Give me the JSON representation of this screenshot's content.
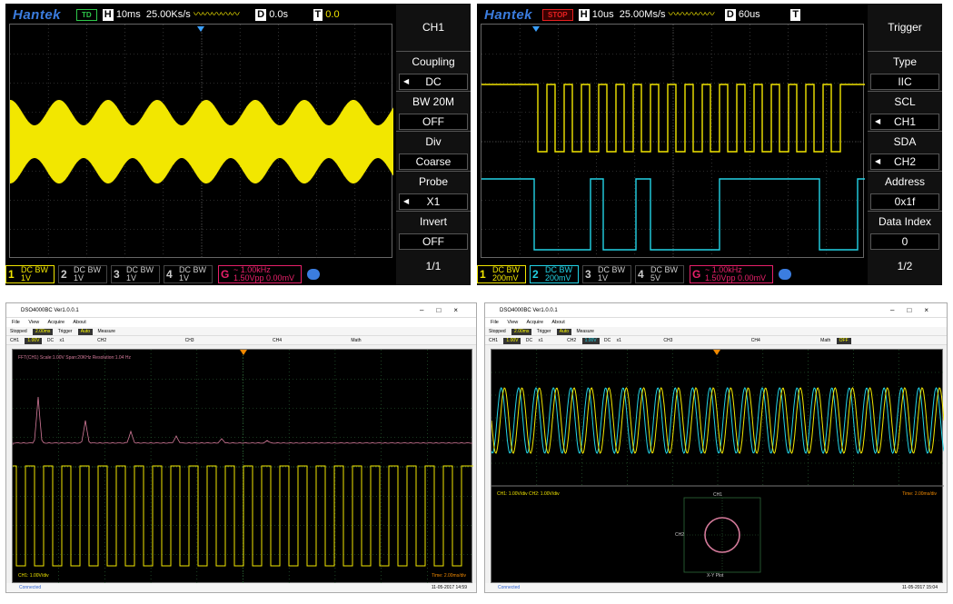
{
  "panels": {
    "tl": {
      "brand": "Hantek",
      "state": "TD",
      "time_base_label": "H",
      "time_base": "10ms",
      "sample_rate": "25.00Ks/s",
      "delay_label": "D",
      "delay": "0.0s",
      "trig_label": "T",
      "trig_level": "0.0",
      "menu_title": "CH1",
      "menu_items": [
        {
          "label": "Coupling",
          "value": "DC",
          "arrow": true
        },
        {
          "label": "BW 20M",
          "value": "OFF"
        },
        {
          "label": "Div",
          "value": "Coarse"
        },
        {
          "label": "Probe",
          "value": "X1",
          "arrow": true
        },
        {
          "label": "Invert",
          "value": "OFF"
        }
      ],
      "page": "1/1",
      "channels": [
        {
          "n": "1",
          "cpl": "DC",
          "bw": "BW",
          "v": "1V"
        },
        {
          "n": "2",
          "cpl": "DC",
          "bw": "BW",
          "v": "1V"
        },
        {
          "n": "3",
          "cpl": "DC",
          "bw": "BW",
          "v": "1V"
        },
        {
          "n": "4",
          "cpl": "DC",
          "bw": "BW",
          "v": "1V"
        }
      ],
      "gen": {
        "l": "G",
        "freq": "1.00kHz",
        "amp": "1.50Vpp",
        "offset": "0.00mV"
      }
    },
    "tr": {
      "brand": "Hantek",
      "state": "STOP",
      "time_base_label": "H",
      "time_base": "10us",
      "sample_rate": "25.00Ms/s",
      "delay_label": "D",
      "delay": "60us",
      "trig_label": "T",
      "menu_title": "Trigger",
      "menu_items": [
        {
          "label": "Type",
          "value": "IIC"
        },
        {
          "label": "SCL",
          "value": "CH1",
          "arrow": true
        },
        {
          "label": "SDA",
          "value": "CH2",
          "arrow": true
        },
        {
          "label": "Address",
          "value": "0x1f"
        },
        {
          "label": "Data Index",
          "value": "0"
        }
      ],
      "page": "1/2",
      "channels": [
        {
          "n": "1",
          "cpl": "DC",
          "bw": "BW",
          "v": "200mV"
        },
        {
          "n": "2",
          "cpl": "DC",
          "bw": "BW",
          "v": "200mV"
        },
        {
          "n": "3",
          "cpl": "DC",
          "bw": "BW",
          "v": "1V"
        },
        {
          "n": "4",
          "cpl": "DC",
          "bw": "BW",
          "v": "5V"
        }
      ],
      "gen": {
        "l": "G",
        "freq": "1.00kHz",
        "amp": "1.50Vpp",
        "offset": "0.00mV"
      }
    },
    "bl": {
      "title": "DSO4000BC Ver1.0.0.1",
      "menu": [
        "File",
        "View",
        "Acquire",
        "About"
      ],
      "toolbar": [
        "Stopped",
        "Trigger",
        "Auto",
        "Measure"
      ],
      "toolbar_chip": "2.00ms",
      "ch_row": [
        "CH1",
        "1.00V",
        "DC",
        "x1",
        "CH2",
        "CH3",
        "CH4",
        "Math"
      ],
      "fft_label": "FFT(CH1)   Scale:1.00V   Span:20KHz   Resolution:1.04 Hz",
      "ch_scale": "CH1: 1.00V/div",
      "time": "Time: 2.00ms/div",
      "status": "Connected",
      "clock": "11-05-2017 14:59"
    },
    "br": {
      "title": "DSO4000BC Ver1.0.0.1",
      "menu": [
        "File",
        "View",
        "Acquire",
        "About"
      ],
      "toolbar": [
        "Stopped",
        "Trigger",
        "Auto",
        "Measure"
      ],
      "toolbar_chip": "2.00ms",
      "ch_row": [
        "CH1",
        "1.00V",
        "DC",
        "x1",
        "CH2",
        "1.00V",
        "DC",
        "x1",
        "CH3",
        "CH4",
        "Math",
        "OFF"
      ],
      "ch_scales": "CH1: 1.00V/div    CH2: 1.00V/div",
      "time": "Time: 2.00ms/div",
      "xy_ch1": "CH1",
      "xy_ch2": "CH2",
      "xy_label": "X-Y Plot",
      "status": "Connected",
      "clock": "11-05-2017 15:04"
    }
  },
  "colors": {
    "ch1": "#f2e600",
    "ch2": "#22d3e6",
    "gen": "#e8206a",
    "brand": "#3b7de0",
    "fft": "#d47a9a"
  }
}
